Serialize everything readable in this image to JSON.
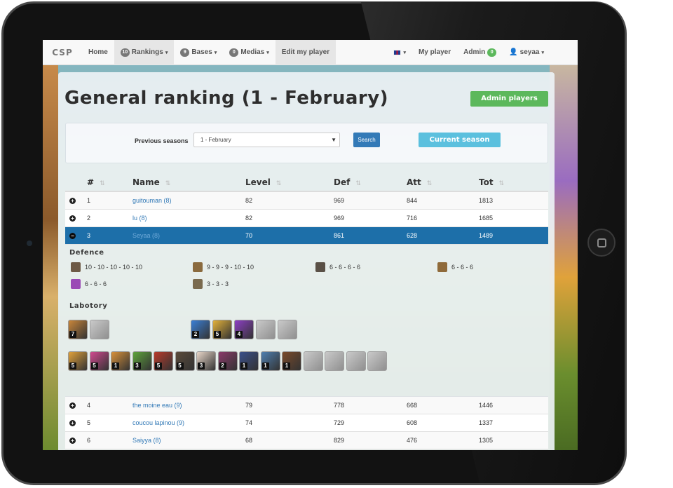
{
  "nav": {
    "brand": "CSP",
    "home": "Home",
    "rankings": {
      "label": "Rankings",
      "count": "10"
    },
    "bases": {
      "label": "Bases",
      "count": "9"
    },
    "medias": {
      "label": "Medias",
      "count": "0"
    },
    "edit_player": "Edit my player",
    "language_icon": "uk-flag-icon",
    "my_player": "My player",
    "admin": {
      "label": "Admin",
      "count": "0"
    },
    "user": "seyaa"
  },
  "page": {
    "title": "General ranking (1 - February)",
    "admin_players_button": "Admin players"
  },
  "filter": {
    "label": "Previous seasons",
    "selected_season": "1 - February",
    "search_button": "Search",
    "current_season_button": "Current season"
  },
  "table": {
    "headers": [
      "#",
      "Name",
      "Level",
      "Def",
      "Att",
      "Tot"
    ],
    "rows_top": [
      {
        "rank": "1",
        "name": "guitouman (8)",
        "level": "82",
        "def": "969",
        "att": "844",
        "tot": "1813"
      },
      {
        "rank": "2",
        "name": "lu (8)",
        "level": "82",
        "def": "969",
        "att": "716",
        "tot": "1685"
      }
    ],
    "selected_row": {
      "rank": "3",
      "name": "Seyaa (8)",
      "level": "70",
      "def": "861",
      "att": "628",
      "tot": "1489"
    },
    "rows_bottom": [
      {
        "rank": "4",
        "name": "the moine eau (9)",
        "level": "79",
        "def": "778",
        "att": "668",
        "tot": "1446"
      },
      {
        "rank": "5",
        "name": "coucou lapinou (9)",
        "level": "74",
        "def": "729",
        "att": "608",
        "tot": "1337"
      },
      {
        "rank": "6",
        "name": "Saiyya (8)",
        "level": "68",
        "def": "829",
        "att": "476",
        "tot": "1305"
      }
    ]
  },
  "details": {
    "defence_title": "Defence",
    "defence": [
      {
        "icon": "cannon-icon",
        "levels": "10 - 10 - 10 - 10 - 10"
      },
      {
        "icon": "archer-tower-icon",
        "levels": "9 - 9 - 9 - 10 - 10"
      },
      {
        "icon": "mortar-icon",
        "levels": "6 - 6 - 6 - 6"
      },
      {
        "icon": "air-defense-icon",
        "levels": "6 - 6 - 6"
      },
      {
        "icon": "wizard-tower-icon",
        "levels": "6 - 6 - 6"
      },
      {
        "icon": "tesla-icon",
        "levels": "3 - 3 - 3"
      }
    ],
    "laboratory_title": "Labotory",
    "heroes": [
      {
        "icon": "barbarian-king-icon",
        "level": "7",
        "color": "#c9863a"
      },
      {
        "icon": "archer-queen-icon",
        "level": "",
        "color": "#9b9b9b"
      }
    ],
    "spells": [
      {
        "icon": "lightning-spell-icon",
        "level": "2",
        "color": "#3b7fd6"
      },
      {
        "icon": "heal-spell-icon",
        "level": "5",
        "color": "#e2b13a"
      },
      {
        "icon": "rage-spell-icon",
        "level": "4",
        "color": "#8d3fc4"
      },
      {
        "icon": "jump-spell-icon",
        "level": "",
        "color": "#a8a8a8"
      },
      {
        "icon": "freeze-spell-icon",
        "level": "",
        "color": "#a8a8a8"
      }
    ],
    "troops": [
      {
        "icon": "barbarian-icon",
        "level": "5",
        "color": "#e0a13b"
      },
      {
        "icon": "archer-icon",
        "level": "5",
        "color": "#d0488f"
      },
      {
        "icon": "giant-icon",
        "level": "1",
        "color": "#d8913a"
      },
      {
        "icon": "goblin-icon",
        "level": "3",
        "color": "#5da33b"
      },
      {
        "icon": "wall-breaker-icon",
        "level": "5",
        "color": "#b83a2a"
      },
      {
        "icon": "wizard-icon",
        "level": "5",
        "color": "#5a4a3a"
      },
      {
        "icon": "healer-icon",
        "level": "3",
        "color": "#e8d6c8"
      },
      {
        "icon": "dragon-icon",
        "level": "2",
        "color": "#8a3a6a"
      },
      {
        "icon": "pekka-icon",
        "level": "1",
        "color": "#3a4f8a"
      },
      {
        "icon": "minion-icon",
        "level": "1",
        "color": "#4f7fb0"
      },
      {
        "icon": "hog-rider-icon",
        "level": "1",
        "color": "#7a4a2a"
      },
      {
        "icon": "valkyrie-icon",
        "level": "",
        "color": "#a8a8a8"
      },
      {
        "icon": "golem-icon",
        "level": "",
        "color": "#a8a8a8"
      },
      {
        "icon": "witch-icon",
        "level": "",
        "color": "#a8a8a8"
      },
      {
        "icon": "lava-hound-icon",
        "level": "",
        "color": "#a8a8a8"
      }
    ]
  }
}
